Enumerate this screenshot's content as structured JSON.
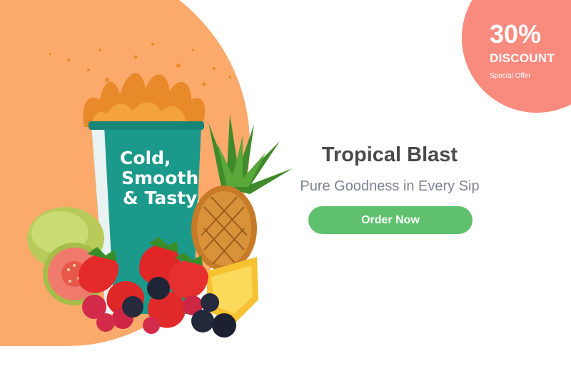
{
  "promo": {
    "percent": "30%",
    "label": "DISCOUNT",
    "note": "Special Offer"
  },
  "cup": {
    "line1": "Cold,",
    "line2": "Smooth",
    "line3": "& Tasty."
  },
  "product": {
    "title": "Tropical Blast",
    "tagline": "Pure Goodness in Every Sip"
  },
  "cta": {
    "label": "Order Now"
  },
  "colors": {
    "orange_background": "#fcaa6c",
    "discount_badge": "#f98b7e",
    "cup_teal": "#1b9a8b",
    "button_green": "#5fc16d",
    "title_text": "#4a4a4a",
    "tagline_text": "#7a8496"
  }
}
